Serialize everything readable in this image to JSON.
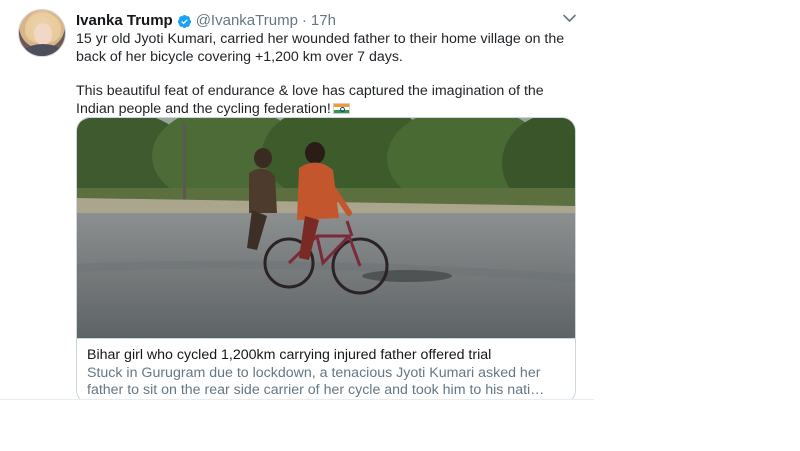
{
  "tweet": {
    "author_name": "Ivanka Trump",
    "author_handle": "@IvankaTrump",
    "separator": "·",
    "time": "17h",
    "avatar_icon": "profile-photo",
    "verified_icon": "verified-badge-icon",
    "verified_color": "#1da1f2",
    "paragraph_1": "15 yr old Jyoti Kumari, carried her wounded father to their home village on the back of her bicycle covering +1,200 km over 7 days.",
    "paragraph_2": "This beautiful feat of endurance & love has captured the imagination of the Indian people and the cycling federation!",
    "flag_icon": "india-flag-icon"
  },
  "card": {
    "title": "Bihar girl who cycled 1,200km carrying injured father offered trial",
    "description": "Stuck in Gurugram due to lockdown, a tenacious Jyoti Kumari asked her father to sit on the rear side carrier of her cycle and took him to his nati…"
  }
}
